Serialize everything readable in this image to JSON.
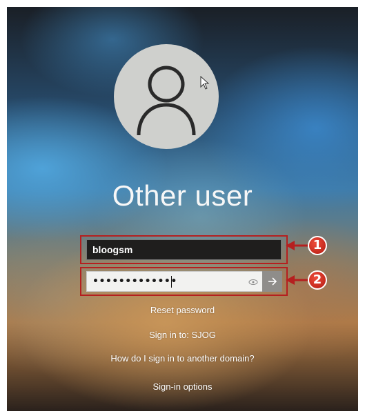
{
  "login": {
    "title": "Other user",
    "username_value": "bloogsm",
    "password_masked": "•••••••••••••",
    "reset_password": "Reset password",
    "sign_in_to": "Sign in to: SJOG",
    "other_domain": "How do I sign in to another domain?",
    "sign_in_options": "Sign-in options"
  },
  "annotations": {
    "step1": "1",
    "step2": "2"
  },
  "icons": {
    "avatar": "user-avatar-icon",
    "reveal": "eye-icon",
    "submit": "arrow-right-icon",
    "pointer": "mouse-cursor-icon"
  },
  "colors": {
    "annotation_red": "#b51f1f",
    "username_bg": "#1f1e1d",
    "password_bg": "#f2f2f0",
    "submit_bg": "#8f8d8a",
    "avatar_bg": "#cfd0cd"
  }
}
